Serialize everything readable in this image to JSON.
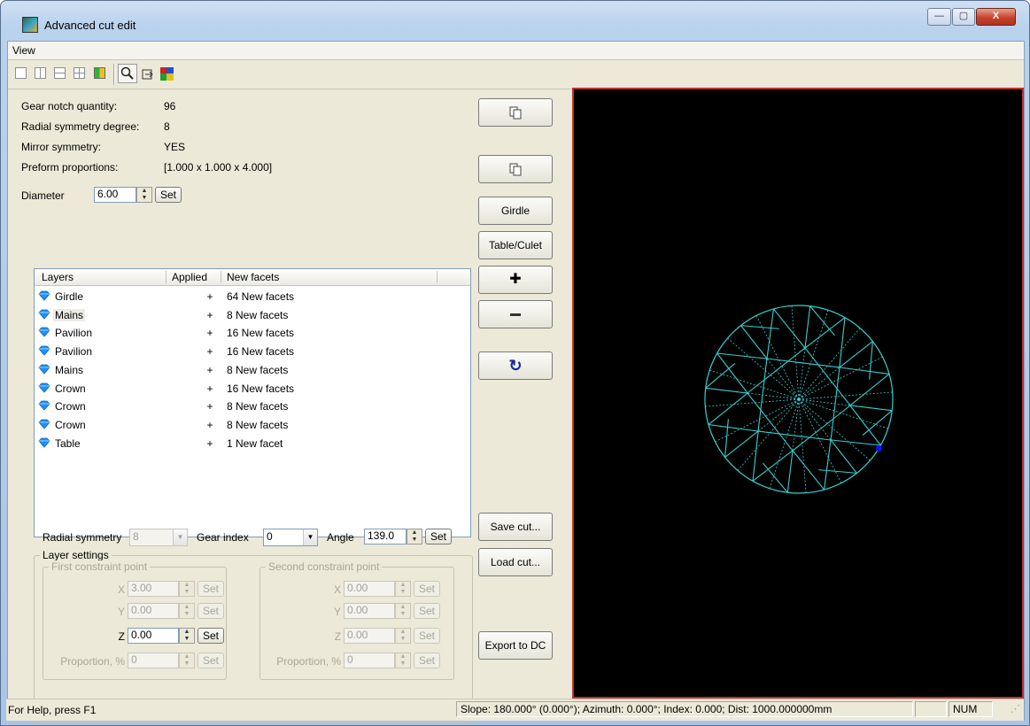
{
  "window": {
    "title": "Advanced cut edit",
    "minimize_label": "—",
    "maximize_label": "▢",
    "close_label": "X"
  },
  "menu": {
    "view_label": "View"
  },
  "info": {
    "gear_notch_label": "Gear notch quantity:",
    "gear_notch_value": "96",
    "radial_sym_label": "Radial symmetry degree:",
    "radial_sym_value": "8",
    "mirror_label": "Mirror symmetry:",
    "mirror_value": "YES",
    "preform_label": "Preform proportions:",
    "preform_value": "[1.000 x 1.000 x 4.000]"
  },
  "diameter": {
    "label": "Diameter",
    "value": "6.00",
    "set_label": "Set"
  },
  "side_buttons": {
    "girdle": "Girdle",
    "table_culet": "Table/Culet",
    "save_cut": "Save cut...",
    "load_cut": "Load cut...",
    "export": "Export to DC"
  },
  "layers": {
    "headers": {
      "layers": "Layers",
      "applied": "Applied",
      "new_facets": "New facets"
    },
    "rows": [
      {
        "name": "Girdle",
        "applied": "+",
        "facets": "64 New facets"
      },
      {
        "name": "Mains",
        "applied": "+",
        "facets": "8 New facets"
      },
      {
        "name": "Pavilion",
        "applied": "+",
        "facets": "16 New facets"
      },
      {
        "name": "Pavilion",
        "applied": "+",
        "facets": "16 New facets"
      },
      {
        "name": "Mains",
        "applied": "+",
        "facets": "8 New facets"
      },
      {
        "name": "Crown",
        "applied": "+",
        "facets": "16 New facets"
      },
      {
        "name": "Crown",
        "applied": "+",
        "facets": "8 New facets"
      },
      {
        "name": "Crown",
        "applied": "+",
        "facets": "8 New facets"
      },
      {
        "name": "Table",
        "applied": "+",
        "facets": "1 New facet"
      }
    ]
  },
  "layer_settings": {
    "title": "Layer settings",
    "radial_symmetry_label": "Radial symmetry",
    "radial_symmetry_value": "8",
    "gear_index_label": "Gear index",
    "gear_index_value": "0",
    "angle_label": "Angle",
    "angle_value": "139.0",
    "set_label": "Set",
    "first_point": {
      "title": "First constraint point",
      "x_label": "X",
      "x_value": "3.00",
      "y_label": "Y",
      "y_value": "0.00",
      "z_label": "Z",
      "z_value": "0.00",
      "proportion_label": "Proportion, %",
      "proportion_value": "0"
    },
    "second_point": {
      "title": "Second constraint point",
      "x_label": "X",
      "x_value": "0.00",
      "y_label": "Y",
      "y_value": "0.00",
      "z_label": "Z",
      "z_value": "0.00",
      "proportion_label": "Proportion, %",
      "proportion_value": "0"
    }
  },
  "status": {
    "help": "For Help, press F1",
    "info": "Slope: 180.000° (0.000°); Azimuth: 0.000°; Index: 0.000; Dist: 1000.000000mm",
    "num": "NUM"
  },
  "colors": {
    "viewport_bg": "#000000",
    "viewport_border": "#c03030",
    "diamond_wire": "#35d0d0",
    "gem_icon": "#1e90ff",
    "selected_vertex": "#1010ff"
  }
}
